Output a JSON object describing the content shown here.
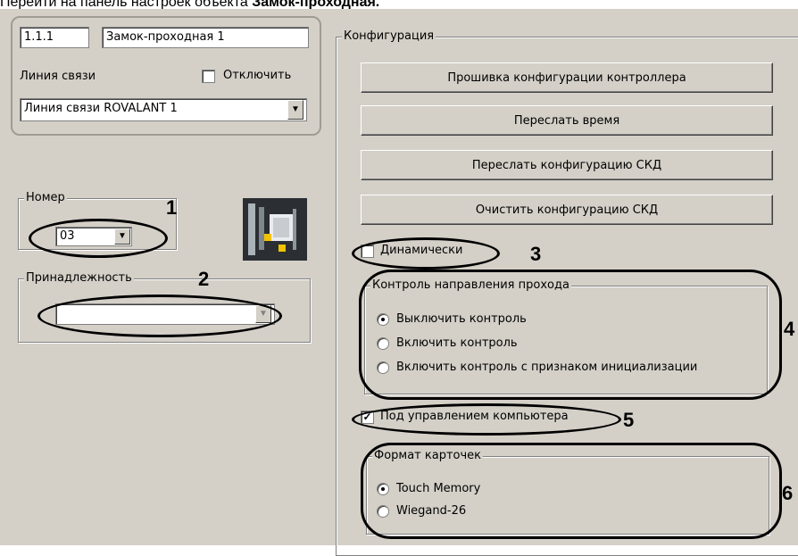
{
  "caption": {
    "prefix": "Перейти на панель настроек объекта ",
    "object": "Замок-проходная."
  },
  "object": {
    "id": "1.1.1",
    "name": "Замок-проходная 1"
  },
  "link": {
    "label": "Линия связи",
    "disable_label": "Отключить",
    "disable_checked": false,
    "value": "Линия связи ROVALANT 1"
  },
  "number_group": {
    "title": "Номер",
    "value": "03"
  },
  "belong_group": {
    "title": "Принадлежность",
    "value": ""
  },
  "config": {
    "title": "Конфигурация",
    "buttons": [
      "Прошивка конфигурации контроллера",
      "Переслать время",
      "Переслать конфигурацию СКД",
      "Очистить конфигурацию СКД"
    ],
    "dynamic_label": "Динамически",
    "dynamic_checked": false,
    "direction": {
      "title": "Контроль направления прохода",
      "options": [
        "Выключить контроль",
        "Включить контроль",
        "Включить контроль с признаком инициализации"
      ],
      "selected": 0
    },
    "pc_control_label": "Под управлением компьютера",
    "pc_control_checked": true,
    "card_format": {
      "title": "Формат карточек",
      "options": [
        "Touch Memory",
        "Wiegand-26"
      ],
      "selected": 0
    }
  },
  "callouts": [
    "1",
    "2",
    "3",
    "4",
    "5",
    "6"
  ]
}
